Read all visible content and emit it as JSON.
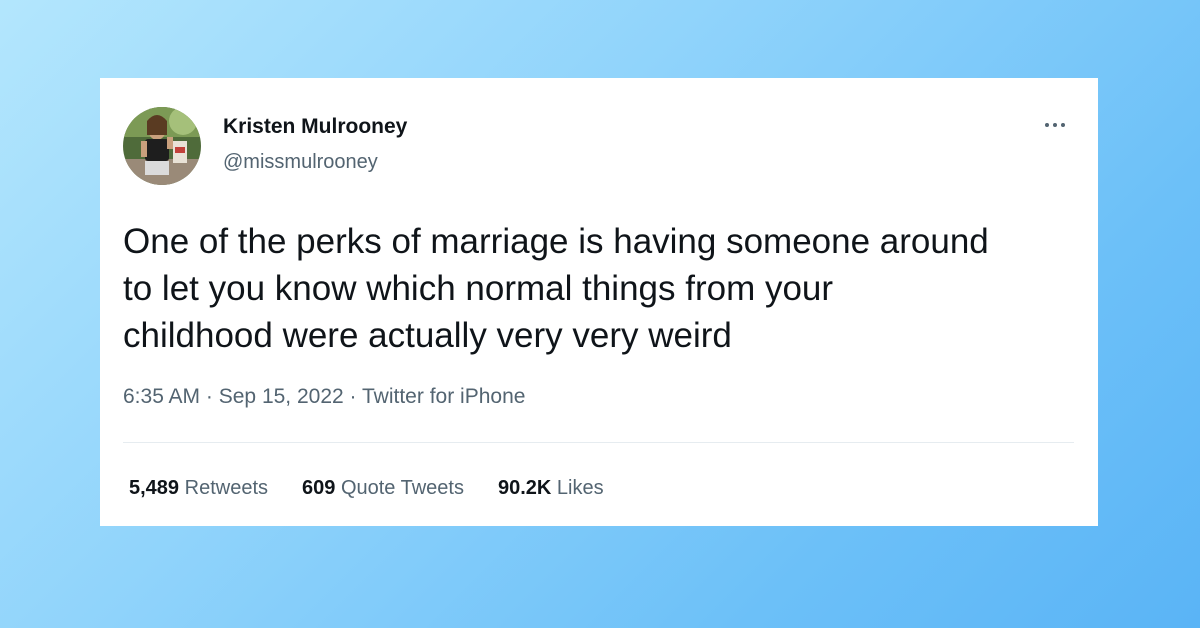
{
  "tweet": {
    "author_name": "Kristen Mulrooney",
    "author_handle": "@missmulrooney",
    "more_icon": "more-horizontal-icon",
    "text": "One of the perks of marriage is having someone around\nto let you know which normal things from your\nchildhood were actually very very weird",
    "meta": {
      "time": "6:35 AM",
      "date": "Sep 15, 2022",
      "source": "Twitter for iPhone",
      "separator": "·"
    },
    "stats": {
      "retweets": {
        "count": "5,489",
        "label": "Retweets"
      },
      "quotes": {
        "count": "609",
        "label": "Quote Tweets"
      },
      "likes": {
        "count": "90.2K",
        "label": "Likes"
      }
    }
  },
  "colors": {
    "background_start": "#b3e6fd",
    "background_end": "#5ab4f6",
    "card": "#ffffff",
    "text_primary": "#0f1419",
    "text_secondary": "#536471",
    "divider": "#e6ecf0"
  }
}
